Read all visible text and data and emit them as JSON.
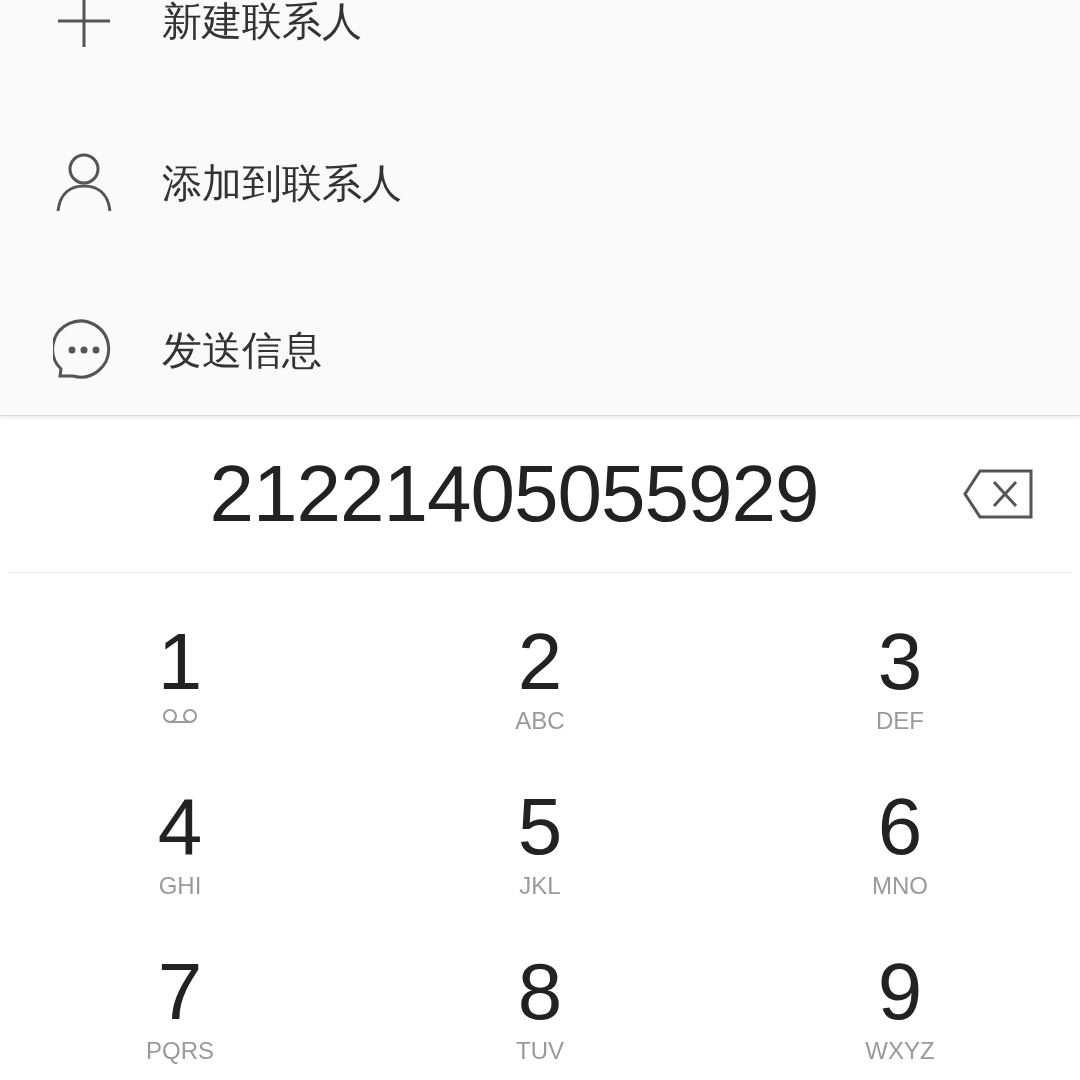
{
  "menu": [
    {
      "kind": "plus",
      "label": "新建联系人"
    },
    {
      "kind": "person",
      "label": "添加到联系人"
    },
    {
      "kind": "message",
      "label": "发送信息"
    }
  ],
  "dialer": {
    "number": "21221405055929"
  },
  "keypad": [
    {
      "digit": "1",
      "kind": "voicemail"
    },
    {
      "digit": "2",
      "letters": "ABC"
    },
    {
      "digit": "3",
      "letters": "DEF"
    },
    {
      "digit": "4",
      "letters": "GHI"
    },
    {
      "digit": "5",
      "letters": "JKL"
    },
    {
      "digit": "6",
      "letters": "MNO"
    },
    {
      "digit": "7",
      "letters": "PQRS"
    },
    {
      "digit": "8",
      "letters": "TUV"
    },
    {
      "digit": "9",
      "letters": "WXYZ"
    }
  ]
}
